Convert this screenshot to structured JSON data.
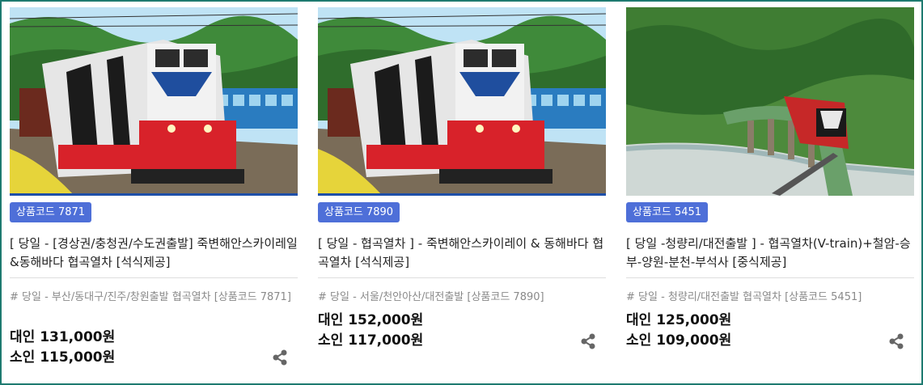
{
  "colors": {
    "border": "#1e7a70",
    "badge": "#4e6fd8",
    "subtitle": "#8a8a8a"
  },
  "products": [
    {
      "image_alt": "train",
      "badge": "상품코드 7871",
      "title": "[ 당일 - [경상권/충청권/수도권출발] 죽변해안스카이레일&동해바다 협곡열차 [석식제공]",
      "subtitle": "# 당일 - 부산/동대구/진주/창원출발 협곡열차 [상품코드 7871]",
      "price_adult": "대인 131,000원",
      "price_child": "소인 115,000원",
      "share_icon": "share-icon"
    },
    {
      "image_alt": "train",
      "badge": "상품코드 7890",
      "title": "[ 당일 - 협곡열차 ] - 죽변해안스카이레이 & 동해바다 협곡열차 [석식제공]",
      "subtitle": "# 당일 - 서울/천안아산/대전출발 [상품코드 7890]",
      "price_adult": "대인 152,000원",
      "price_child": "소인 117,000원",
      "share_icon": "share-icon"
    },
    {
      "image_alt": "train on bridge",
      "badge": "상품코드 5451",
      "title": "[ 당일 -청량리/대전출발 ] - 협곡열차(V-train)+철암-승부-양원-분천-부석사 [중식제공]",
      "subtitle": "# 당일 - 청량리/대전출발 협곡열차 [상품코드 5451]",
      "price_adult": "대인 125,000원",
      "price_child": "소인 109,000원",
      "share_icon": "share-icon"
    }
  ]
}
